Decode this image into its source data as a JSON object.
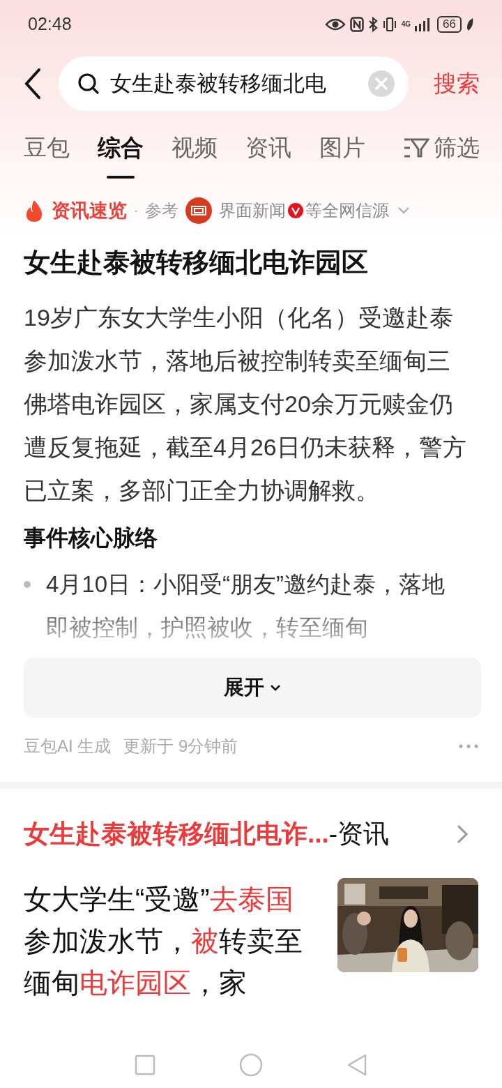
{
  "status_bar": {
    "time": "02:48",
    "network": "4G",
    "battery": "66"
  },
  "search": {
    "value": "女生赴泰被转移缅北电",
    "submit": "搜索"
  },
  "tabs": [
    {
      "label": "豆包",
      "selected": false
    },
    {
      "label": "综合",
      "selected": true
    },
    {
      "label": "视频",
      "selected": false
    },
    {
      "label": "资讯",
      "selected": false
    },
    {
      "label": "图片",
      "selected": false
    }
  ],
  "filter": "筛选",
  "summary": {
    "badge": "资讯速览",
    "separator": "·",
    "reference": "参考",
    "source": "界面新闻",
    "sources_suffix": "等全网信源",
    "headline": "女生赴泰被转移缅北电诈园区",
    "body": "19岁广东女大学生小阳（化名）受邀赴泰参加泼水节，落地后被控制转卖至缅甸三佛塔电诈园区，家属支付20余万元赎金仍遭反复拖延，截至4月26日仍未获释，警方已立案，多部门正全力协调解救。",
    "section_title": "事件核心脉络",
    "bullets": [
      "4月10日：小阳受“朋友”邀约赴泰，落地即被控制，护照被收，转至缅甸"
    ],
    "expand": "展开",
    "generated_by": "豆包AI 生成",
    "updated": "更新于 9分钟前"
  },
  "result": {
    "title": [
      {
        "text": "女生赴泰被转移缅北电诈...",
        "highlight": true
      },
      {
        "text": "-资讯",
        "highlight": false
      }
    ],
    "snippet": [
      {
        "text": "女大学生“受邀”",
        "highlight": false
      },
      {
        "text": "去泰国",
        "highlight": true
      },
      {
        "text": "参加泼水节，",
        "highlight": false
      },
      {
        "text": "被",
        "highlight": true
      },
      {
        "text": "转卖至缅甸",
        "highlight": false
      },
      {
        "text": "电诈园区",
        "highlight": true
      },
      {
        "text": "，家",
        "highlight": false
      }
    ]
  }
}
